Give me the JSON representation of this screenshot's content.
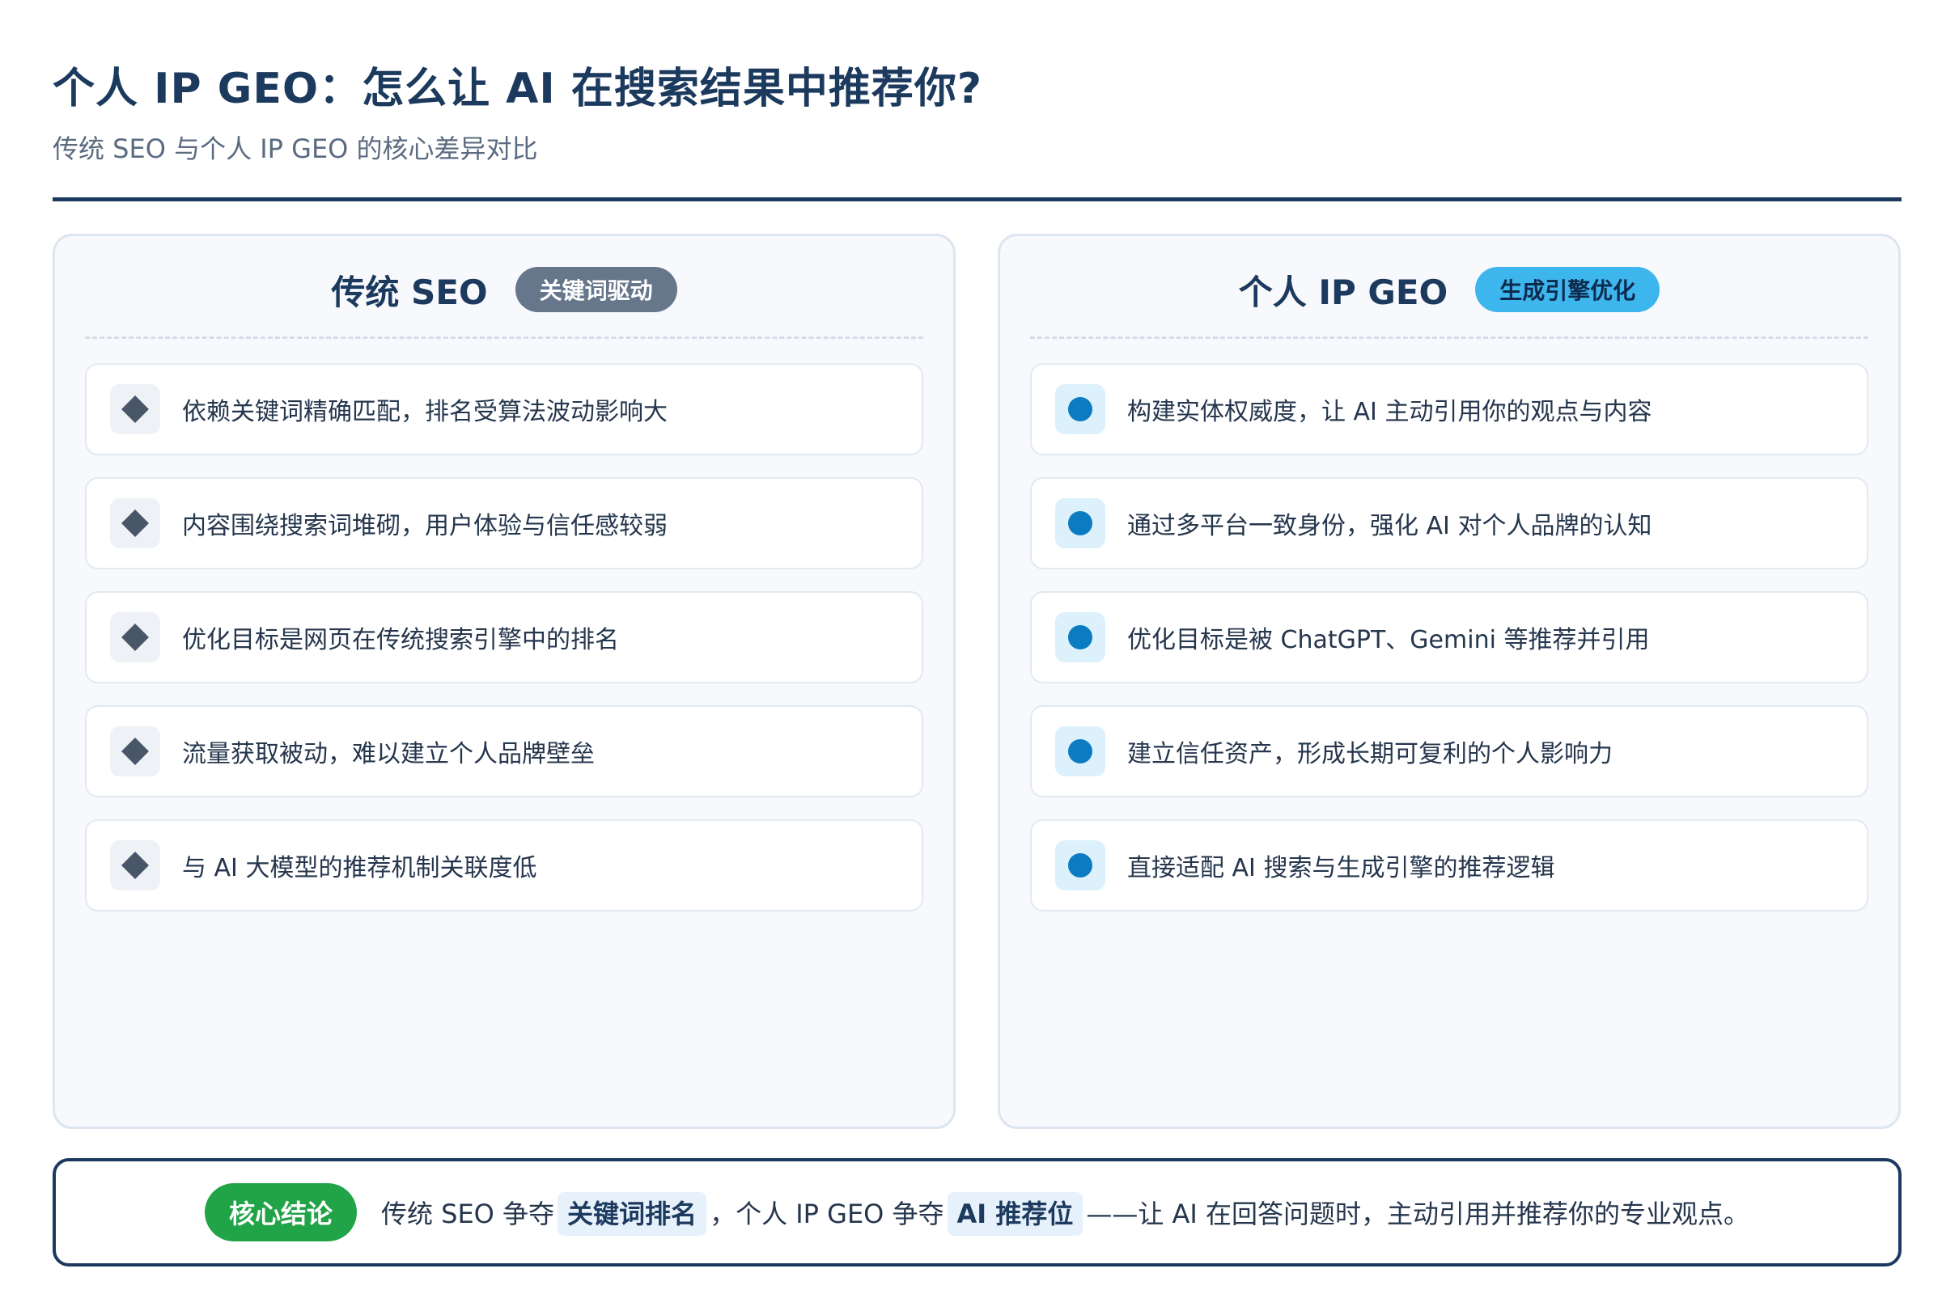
{
  "header": {
    "title": "个人 IP GEO：怎么让 AI 在搜索结果中推荐你?",
    "subtitle": "传统 SEO 与个人 IP GEO 的核心差异对比"
  },
  "left": {
    "title": "传统 SEO",
    "pill": "关键词驱动",
    "items": [
      "依赖关键词精确匹配，排名受算法波动影响大",
      "内容围绕搜索词堆砌，用户体验与信任感较弱",
      "优化目标是网页在传统搜索引擎中的排名",
      "流量获取被动，难以建立个人品牌壁垒",
      "与 AI 大模型的推荐机制关联度低"
    ]
  },
  "right": {
    "title": "个人 IP GEO",
    "pill": "生成引擎优化",
    "items": [
      "构建实体权威度，让 AI 主动引用你的观点与内容",
      "通过多平台一致身份，强化 AI 对个人品牌的认知",
      "优化目标是被 ChatGPT、Gemini 等推荐并引用",
      "建立信任资产，形成长期可复利的个人影响力",
      "直接适配 AI 搜索与生成引擎的推荐逻辑"
    ]
  },
  "conclusion": {
    "badge": "核心结论",
    "part1": "传统 SEO 争夺",
    "hl1": "关键词排名",
    "part2": "，个人 IP GEO 争夺",
    "hl2": "AI 推荐位",
    "part3": "——让 AI 在回答问题时，主动引用并推荐你的专业观点。"
  },
  "colors": {
    "primary": "#1c3a5e",
    "gray_pill": "#66768b",
    "blue_pill": "#3db6ee",
    "dot_blue": "#0c7cc2",
    "badge_green": "#21a348"
  }
}
